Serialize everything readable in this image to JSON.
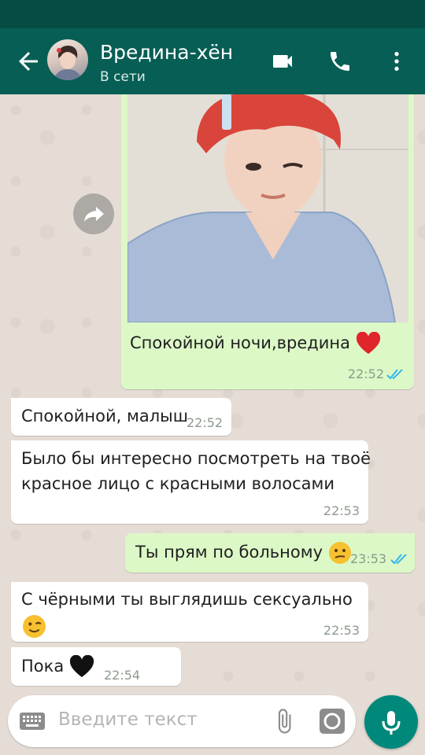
{
  "header": {
    "contact_name": "Вредина-хён",
    "contact_status": "В сети",
    "icons": [
      "back-arrow-icon",
      "video-call-icon",
      "phone-icon",
      "more-vert-icon"
    ],
    "colors": {
      "app_bar": "#075e54",
      "status_bar": "#054d44"
    }
  },
  "messages": [
    {
      "direction": "out",
      "type": "image",
      "caption": "Спокойной ночи,вредина",
      "emoji": "red-heart",
      "time": "22:52",
      "read": true
    },
    {
      "direction": "in",
      "text": "Спокойной, малыш",
      "time": "22:52"
    },
    {
      "direction": "in",
      "text_line1": "Было бы интересно посмотреть на твоё",
      "text_line2": "красное лицо с красными волосами",
      "time": "22:53"
    },
    {
      "direction": "out",
      "text": "Ты прям по больному",
      "emoji": "confused-face",
      "time": "23:53",
      "read": true
    },
    {
      "direction": "in",
      "text": "С чёрными ты выглядишь сексуально",
      "emoji": "winking-face",
      "time": "22:53"
    },
    {
      "direction": "in",
      "text": "Пока",
      "emoji": "black-heart",
      "time": "22:54"
    }
  ],
  "input": {
    "placeholder": "Введите текст",
    "icons": [
      "keyboard-icon",
      "attach-icon",
      "camera-icon",
      "mic-icon"
    ]
  },
  "colors": {
    "outgoing_bubble": "#dcf8c6",
    "incoming_bubble": "#ffffff",
    "read_ticks": "#34b7f1",
    "accent": "#00897b"
  }
}
